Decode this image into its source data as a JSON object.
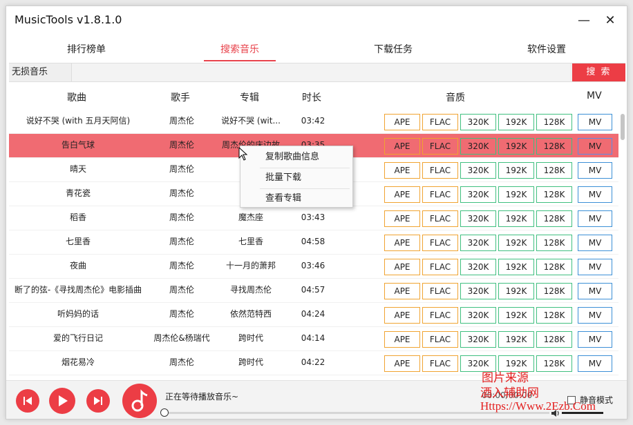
{
  "window": {
    "title": "MusicTools v1.8.1.0",
    "minimize": "—",
    "close": "✕"
  },
  "tabs": [
    {
      "label": "排行榜单",
      "active": false
    },
    {
      "label": "搜索音乐",
      "active": true
    },
    {
      "label": "下载任务",
      "active": false
    },
    {
      "label": "软件设置",
      "active": false
    }
  ],
  "search": {
    "source": "无损音乐",
    "query": "",
    "button": "搜 索"
  },
  "table": {
    "headers": {
      "song": "歌曲",
      "artist": "歌手",
      "album": "专辑",
      "duration": "时长",
      "quality": "音质",
      "mv": "MV"
    },
    "quality_labels": [
      "APE",
      "FLAC",
      "320K",
      "192K",
      "128K"
    ],
    "mv_label": "MV",
    "selected_index": 1,
    "rows": [
      {
        "song": "说好不哭 (with 五月天阿信)",
        "artist": "周杰伦",
        "album": "说好不哭 (wit...",
        "duration": "03:42"
      },
      {
        "song": "告白气球",
        "artist": "周杰伦",
        "album": "周杰伦的床边故",
        "duration": "03:35"
      },
      {
        "song": "晴天",
        "artist": "周杰伦",
        "album": "叶",
        "duration": ""
      },
      {
        "song": "青花瓷",
        "artist": "周杰伦",
        "album": "我",
        "duration": ""
      },
      {
        "song": "稻香",
        "artist": "周杰伦",
        "album": "魔杰座",
        "duration": "03:43"
      },
      {
        "song": "七里香",
        "artist": "周杰伦",
        "album": "七里香",
        "duration": "04:58"
      },
      {
        "song": "夜曲",
        "artist": "周杰伦",
        "album": "十一月的萧邦",
        "duration": "03:46"
      },
      {
        "song": "断了的弦-《寻找周杰伦》电影插曲",
        "artist": "周杰伦",
        "album": "寻找周杰伦",
        "duration": "04:57"
      },
      {
        "song": "听妈妈的话",
        "artist": "周杰伦",
        "album": "依然范特西",
        "duration": "04:24"
      },
      {
        "song": "爱的飞行日记",
        "artist": "周杰伦&杨瑞代",
        "album": "跨时代",
        "duration": "04:14"
      },
      {
        "song": "烟花易冷",
        "artist": "周杰伦",
        "album": "跨时代",
        "duration": "04:22"
      }
    ]
  },
  "context_menu": {
    "items": [
      "复制歌曲信息",
      "批量下载",
      "查看专辑"
    ]
  },
  "player": {
    "status": "正在等待播放音乐~",
    "time": "00:00/00:00",
    "progress": 0,
    "mute_label": "静音模式",
    "muted": false
  },
  "watermark": {
    "line1": "图片来源",
    "line2": "酒入辅助网",
    "line3": "Https://Www.2Ezb.Com"
  },
  "colors": {
    "accent": "#ec3d45",
    "selected_row": "#f06b72",
    "lossless_border": "#f0a330",
    "mp3_border": "#3fbf7f",
    "mv_border": "#3b8fd6"
  }
}
